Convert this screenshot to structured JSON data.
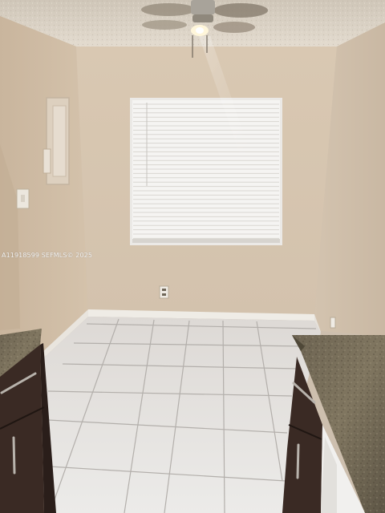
{
  "photo": {
    "subject": "empty-room-with-window-and-tiled-floor",
    "watermark": "A11918599 SEFMLS© 2025"
  },
  "colors": {
    "wall_back": "#d8c8b4",
    "wall_left": "#cdbba5",
    "wall_right": "#cfbeaa",
    "ceiling": "#dcd3c6",
    "floor_tile": "#e6e4e2",
    "grout": "#b9b5b1",
    "baseboard": "#efece6",
    "blind": "#f2f1ef",
    "cabinet": "#3a2a24",
    "granite": "#6f6655"
  },
  "icons": {
    "fan": "ceiling-fan-icon",
    "outlet": "electrical-outlet-icon",
    "switch": "light-switch-icon"
  }
}
